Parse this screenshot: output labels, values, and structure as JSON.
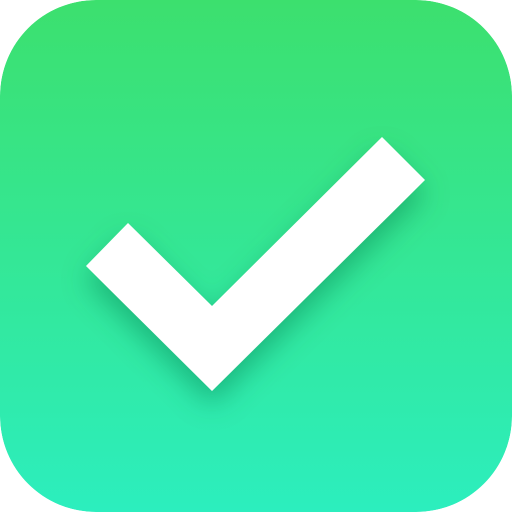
{
  "icon": {
    "name": "checkmark-icon",
    "gradient_top": "#3ce06e",
    "gradient_bottom": "#2ceebe",
    "mark_color": "#ffffff",
    "shadow_color": "#0b7a4e"
  }
}
